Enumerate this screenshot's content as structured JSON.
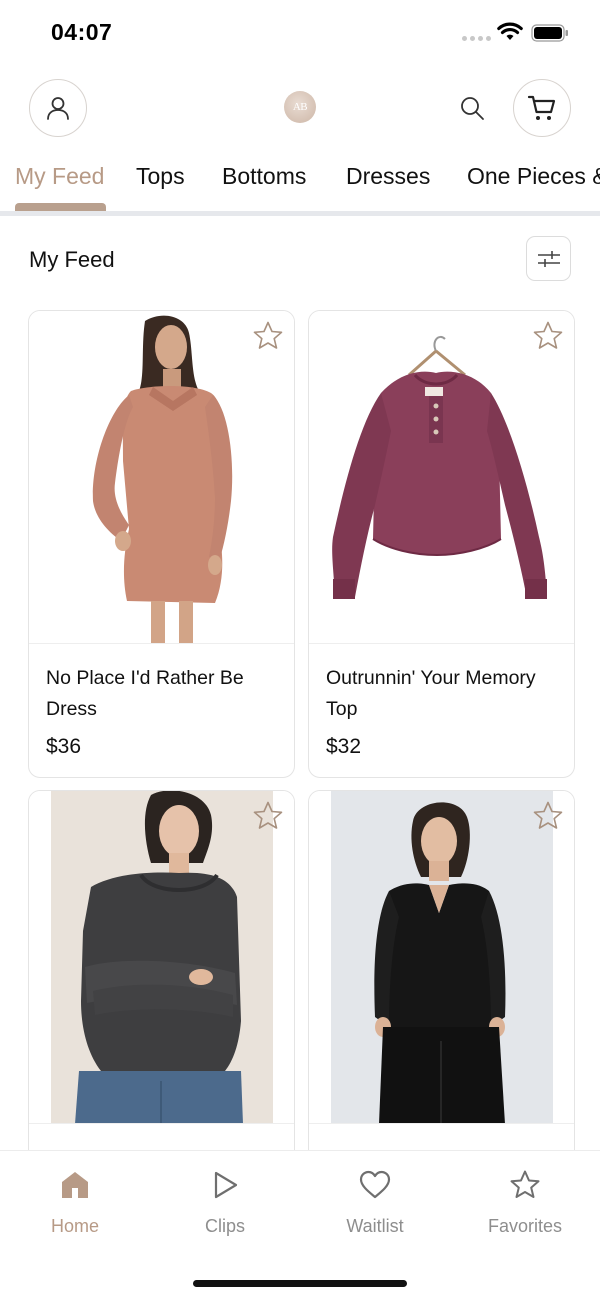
{
  "status_bar": {
    "time": "04:07"
  },
  "header": {
    "logo_text": "AB"
  },
  "tabs": [
    {
      "label": "My Feed",
      "active": true
    },
    {
      "label": "Tops",
      "active": false
    },
    {
      "label": "Bottoms",
      "active": false
    },
    {
      "label": "Dresses",
      "active": false
    },
    {
      "label": "One Pieces &",
      "active": false
    }
  ],
  "section": {
    "title": "My Feed"
  },
  "products": [
    {
      "name": "No Place I'd Rather Be Dress",
      "price": "$36",
      "image": "model-in-pink-sweater-dress"
    },
    {
      "name": "Outrunnin' Your Memory Top",
      "price": "$32",
      "image": "plum-henley-top-on-hanger"
    },
    {
      "name": "",
      "price": "",
      "image": "model-in-charcoal-waffle-top"
    },
    {
      "name": "",
      "price": "",
      "image": "model-in-black-v-neck-top"
    }
  ],
  "bottom_nav": [
    {
      "label": "Home",
      "icon": "home-icon",
      "active": true
    },
    {
      "label": "Clips",
      "icon": "play-icon",
      "active": false
    },
    {
      "label": "Waitlist",
      "icon": "heart-icon",
      "active": false
    },
    {
      "label": "Favorites",
      "icon": "star-icon",
      "active": false
    }
  ],
  "colors": {
    "accent": "#b79a86",
    "tab_underline": "#b9a08e",
    "divider": "#e6e8ec",
    "inactive_nav": "#8e8e8e"
  }
}
